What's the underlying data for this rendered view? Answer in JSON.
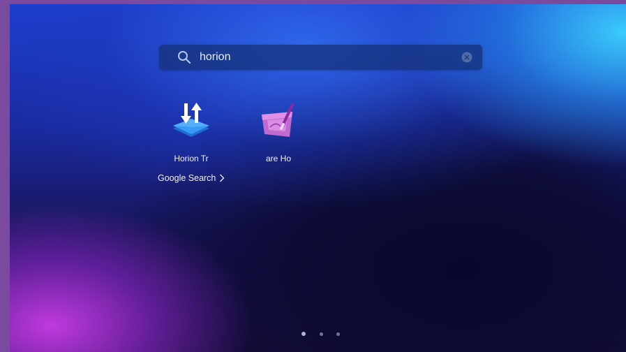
{
  "search": {
    "query": "horion"
  },
  "results": {
    "apps": [
      {
        "label": "Horion Tr",
        "icon": "transfer-arrows-icon"
      },
      {
        "label": "are   Ho",
        "icon": "drawing-tablet-icon"
      }
    ],
    "web_search": {
      "label": "Google Search",
      "icon": "chevron-right-icon"
    }
  },
  "pagination": {
    "pages": 3,
    "current": 1
  },
  "colors": {
    "accent_top_right": "#3cd2ff",
    "accent_bottom_left": "#c83ce6",
    "background_dark": "#150d3a",
    "search_bar": "#163278"
  }
}
